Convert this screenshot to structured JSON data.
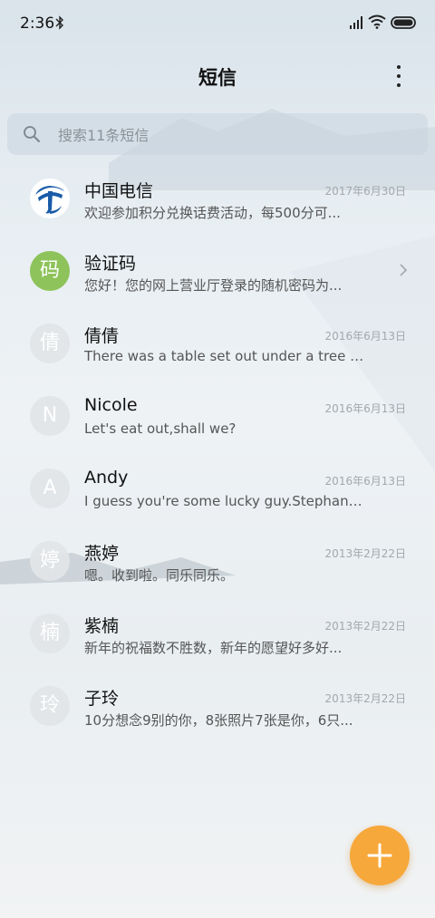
{
  "status_bar": {
    "time": "2:36"
  },
  "header": {
    "title": "短信"
  },
  "search": {
    "placeholder": "搜索11条短信"
  },
  "conversations": [
    {
      "name": "中国电信",
      "snippet": "欢迎参加积分兑换话费活动，每500分可...",
      "date": "2017年6月30日",
      "avatar_text": "",
      "avatar_icon": "china-telecom-logo-icon"
    },
    {
      "name": "验证码",
      "snippet": "您好！您的网上营业厅登录的随机密码为...",
      "date": "",
      "avatar_text": "码",
      "avatar_color": "#8dc35a"
    },
    {
      "name": "倩倩",
      "snippet": "There was a table set out under a tree i...",
      "date": "2016年6月13日",
      "avatar_text": "倩"
    },
    {
      "name": "Nicole",
      "snippet": "Let's eat out,shall we?",
      "date": "2016年6月13日",
      "avatar_text": "N"
    },
    {
      "name": "Andy",
      "snippet": "I guess you're some lucky guy.Stephani...",
      "date": "2016年6月13日",
      "avatar_text": "A"
    },
    {
      "name": "燕婷",
      "snippet": "嗯。收到啦。同乐同乐。",
      "date": "2013年2月22日",
      "avatar_text": "婷"
    },
    {
      "name": "紫楠",
      "snippet": "新年的祝福数不胜数，新年的愿望好多好...",
      "date": "2013年2月22日",
      "avatar_text": "楠"
    },
    {
      "name": "子玲",
      "snippet": "10分想念9别的你，8张照片7张是你，6只...",
      "date": "2013年2月22日",
      "avatar_text": "玲"
    }
  ],
  "colors": {
    "fab": "#f7a83a",
    "accent_green": "#8dc35a",
    "telecom_blue": "#1a5ba8"
  }
}
